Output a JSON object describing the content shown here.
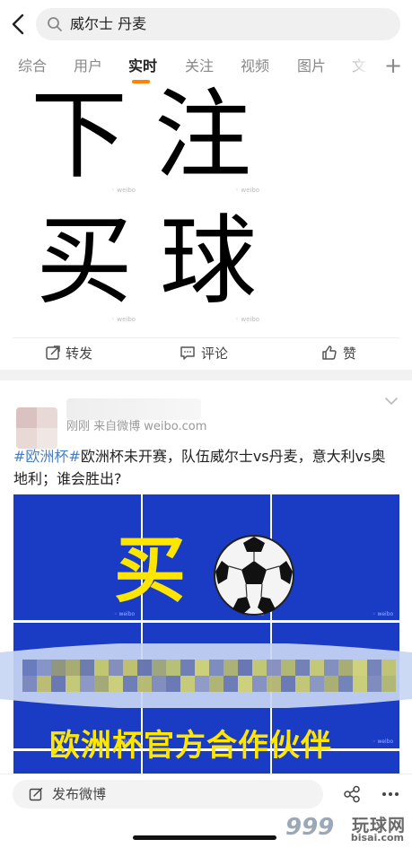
{
  "search": {
    "query": "威尔士 丹麦"
  },
  "tabs": [
    {
      "label": "综合"
    },
    {
      "label": "用户"
    },
    {
      "label": "实时"
    },
    {
      "label": "关注"
    },
    {
      "label": "视频"
    },
    {
      "label": "图片"
    },
    {
      "label": "文"
    }
  ],
  "active_tab": "实时",
  "accent_color": "#ff8200",
  "post1": {
    "image_chars": [
      "下",
      "注",
      "买",
      "球"
    ],
    "actions": {
      "repost": "转发",
      "comment": "评论",
      "like": "赞"
    }
  },
  "post2": {
    "meta": "刚刚  来自微博 weibo.com",
    "hashtag": "#欧洲杯#",
    "text": "欧洲杯未开赛，队伍威尔士vs丹麦，意大利vs奥地利；谁会胜出?",
    "image_text_top": "买",
    "image_text_bottom": "欧洲杯官方合作伙伴"
  },
  "bottom": {
    "compose_label": "发布微博",
    "watermark_text": "玩球网",
    "watermark_num": "999",
    "watermark_url": "bisai.com"
  }
}
